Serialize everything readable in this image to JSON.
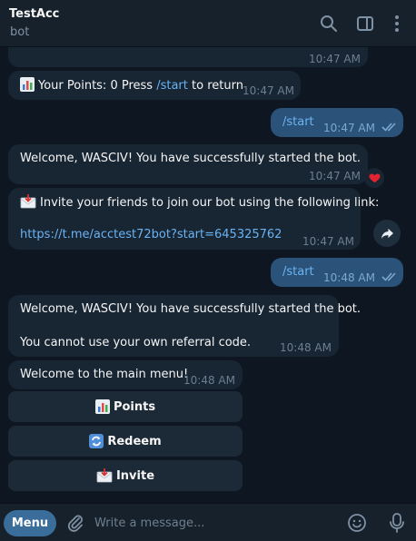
{
  "header": {
    "title": "TestAcc",
    "subtitle": "bot"
  },
  "messages": {
    "top_time": "10:47 AM",
    "points": {
      "text_before": "Your Points: 0 Press ",
      "command": "/start",
      "text_after": " to return",
      "time": "10:47 AM"
    },
    "out1": {
      "text": "/start",
      "time": "10:47 AM"
    },
    "welcome1": {
      "text": "Welcome, WASCIV! You have successfully started the bot.",
      "time": "10:47 AM",
      "reaction": "heart"
    },
    "invite": {
      "text": "Invite your friends to join our bot using the following link:",
      "link": "https://t.me/acctest72bot?start=645325762",
      "time": "10:47 AM"
    },
    "out2": {
      "text": "/start",
      "time": "10:48 AM"
    },
    "welcome2": {
      "line1": "Welcome, WASCIV! You have successfully started the bot.",
      "line2": "You cannot use your own referral code.",
      "time": "10:48 AM"
    },
    "menu": {
      "text": "Welcome to the main menu!",
      "time": "10:48 AM"
    }
  },
  "keyboard": {
    "points": "Points",
    "redeem": "Redeem",
    "invite": "Invite"
  },
  "composer": {
    "menu_label": "Menu",
    "placeholder": "Write a message..."
  },
  "colors": {
    "background": "#0e1621",
    "incoming": "#182533",
    "outgoing": "#2b5278",
    "accent": "#6ab3f3",
    "menu_button": "#3a6d99"
  }
}
